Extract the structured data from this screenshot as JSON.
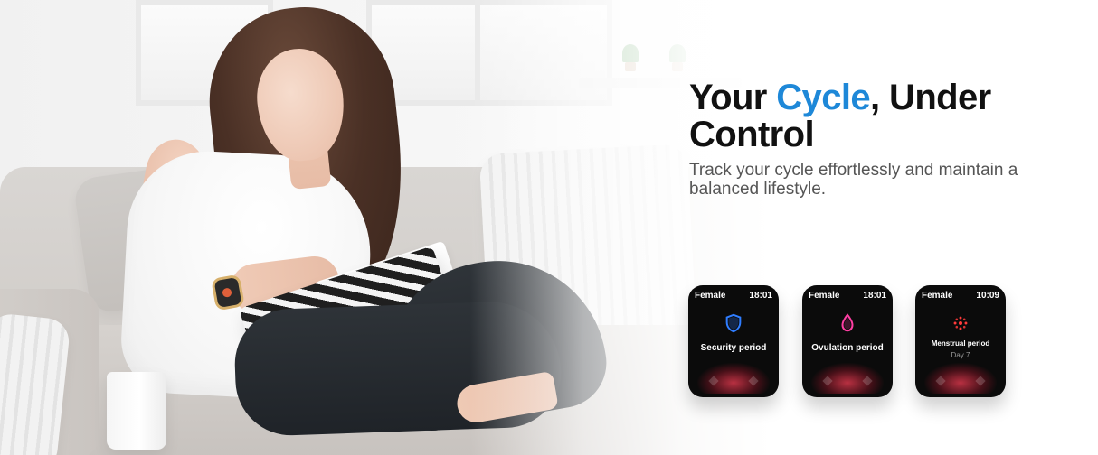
{
  "headline": {
    "pre": "Your ",
    "accent": "Cycle",
    "post": ", Under Control",
    "accent_color": "#1e88d8"
  },
  "subcopy": "Track your cycle effortlessly and maintain a balanced lifestyle.",
  "watches": [
    {
      "label": "Female",
      "time": "18:01",
      "period": "Security period",
      "icon": "shield-icon",
      "icon_color": "#2f7dff"
    },
    {
      "label": "Female",
      "time": "18:01",
      "period": "Ovulation period",
      "icon": "droplet-icon",
      "icon_color": "#ff3fa3"
    },
    {
      "label": "Female",
      "time": "10:09",
      "period": "Menstrual period",
      "day": "Day 7",
      "icon": "cycle-flower-icon",
      "icon_color": "#ff3b3b"
    }
  ],
  "colors": {
    "background": "#ffffff",
    "text": "#111111",
    "subtext": "#555555"
  }
}
